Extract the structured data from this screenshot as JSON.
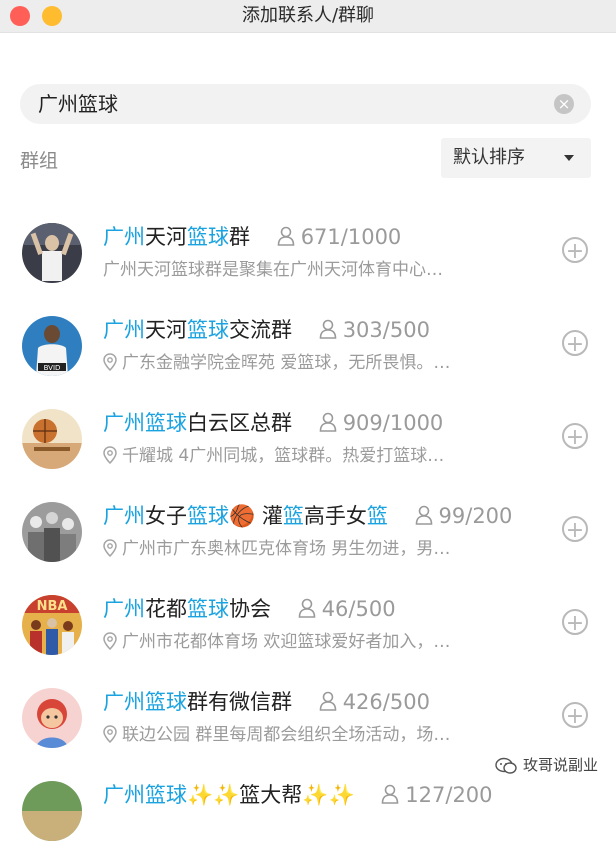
{
  "window": {
    "title": "添加联系人/群聊"
  },
  "search": {
    "value": "广州篮球"
  },
  "section": {
    "label": "群组"
  },
  "sort": {
    "label": "默认排序"
  },
  "groups": [
    {
      "name_parts": [
        {
          "text": "广州",
          "hl": true
        },
        {
          "text": "天河",
          "hl": false
        },
        {
          "text": "篮球",
          "hl": true
        },
        {
          "text": "群",
          "hl": false
        }
      ],
      "members": "671/1000",
      "has_location": false,
      "description": "广州天河篮球群是聚集在广州天河体育中心…"
    },
    {
      "name_parts": [
        {
          "text": "广州",
          "hl": true
        },
        {
          "text": "天河",
          "hl": false
        },
        {
          "text": "篮球",
          "hl": true
        },
        {
          "text": "交流群",
          "hl": false
        }
      ],
      "members": "303/500",
      "has_location": true,
      "description": "广东金融学院金晖苑  爱篮球，无所畏惧。…"
    },
    {
      "name_parts": [
        {
          "text": "广州",
          "hl": true
        },
        {
          "text": "篮球",
          "hl": true
        },
        {
          "text": "白云区总群",
          "hl": false
        }
      ],
      "members": "909/1000",
      "has_location": true,
      "description": "千耀城  4广州同城，篮球群。热爱打篮球…"
    },
    {
      "name_parts": [
        {
          "text": "广州",
          "hl": true
        },
        {
          "text": "女子",
          "hl": false
        },
        {
          "text": "篮球",
          "hl": true
        },
        {
          "text": "🏀 灌",
          "hl": false
        },
        {
          "text": "篮",
          "hl": true
        },
        {
          "text": "高手女",
          "hl": false
        },
        {
          "text": "篮",
          "hl": true
        }
      ],
      "members": "99/200",
      "has_location": true,
      "description": "广州市广东奥林匹克体育场  男生勿进，男…"
    },
    {
      "name_parts": [
        {
          "text": "广州",
          "hl": true
        },
        {
          "text": "花都",
          "hl": false
        },
        {
          "text": "篮球",
          "hl": true
        },
        {
          "text": "协会",
          "hl": false
        }
      ],
      "members": "46/500",
      "has_location": true,
      "description": "广州市花都体育场  欢迎篮球爱好者加入，…"
    },
    {
      "name_parts": [
        {
          "text": "广州",
          "hl": true
        },
        {
          "text": "篮球",
          "hl": true
        },
        {
          "text": "群有微信群",
          "hl": false
        }
      ],
      "members": "426/500",
      "has_location": true,
      "description": "联边公园  群里每周都会组织全场活动，场…"
    },
    {
      "name_parts": [
        {
          "text": "广州",
          "hl": true
        },
        {
          "text": "篮球",
          "hl": true
        },
        {
          "text": "✨✨篮",
          "hl": false
        },
        {
          "text": "大帮",
          "hl": false
        },
        {
          "text": "✨✨",
          "hl": false
        }
      ],
      "members": "127/200",
      "has_location": false,
      "description": ""
    }
  ],
  "watermark": {
    "text": "玫哥说副业"
  }
}
